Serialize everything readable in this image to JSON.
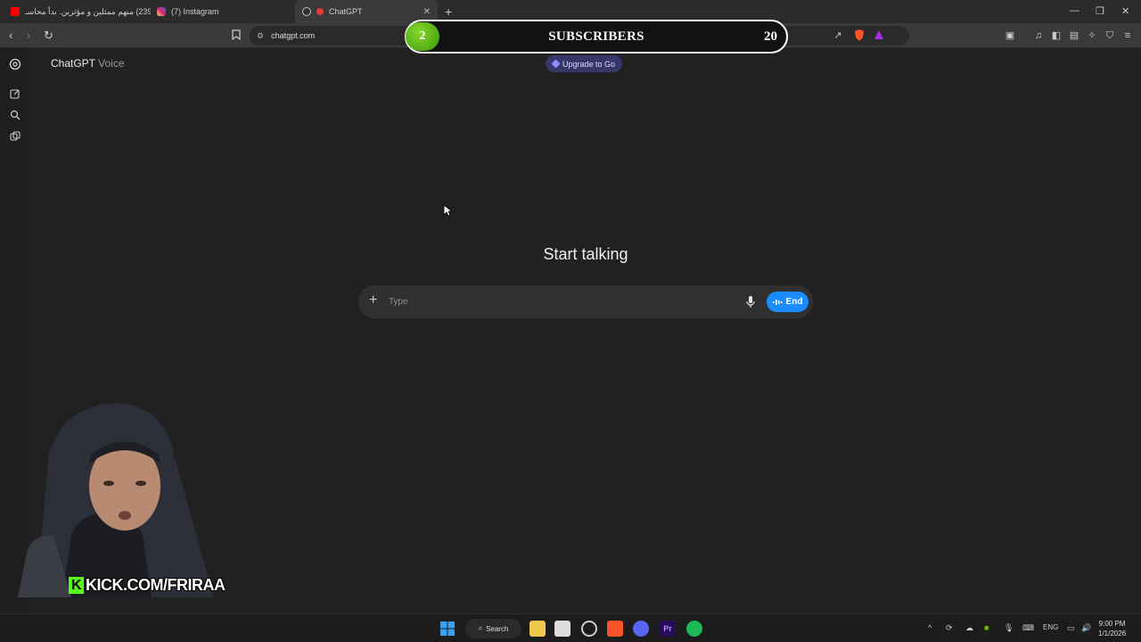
{
  "browser": {
    "tabs": [
      {
        "label": "(239) منهم ممثلين و مؤثرين. بدأ محاسـ",
        "icon": "youtube-icon",
        "color": "#ff0000"
      },
      {
        "label": "(7) Instagram",
        "icon": "instagram-icon",
        "color": "#d62976"
      },
      {
        "label": "ChatGPT",
        "icon": "chatgpt-icon",
        "color": "#cccccc"
      }
    ],
    "active_tab": 2,
    "url": "chatgpt.com"
  },
  "overlay": {
    "label": "SUBSCRIBERS",
    "current": "2",
    "goal": "20"
  },
  "app": {
    "title": "ChatGPT",
    "subtitle": "Voice",
    "upgrade_label": "Upgrade to Go",
    "heading": "Start talking",
    "composer": {
      "placeholder": "Type",
      "end_label": "End"
    },
    "sidebar_icons": [
      "chatgpt-logo-icon",
      "new-chat-icon",
      "search-icon",
      "library-icon"
    ]
  },
  "stream": {
    "handle": "KICK.COM/FRIRAA",
    "brand_color": "#53fc18"
  },
  "taskbar": {
    "search_label": "Search",
    "language": "ENG",
    "time": "9:00 PM",
    "date": "1/1/2026"
  },
  "colors": {
    "accent": "#1a8cff",
    "upgrade_bg": "#373669",
    "background": "#212121"
  }
}
